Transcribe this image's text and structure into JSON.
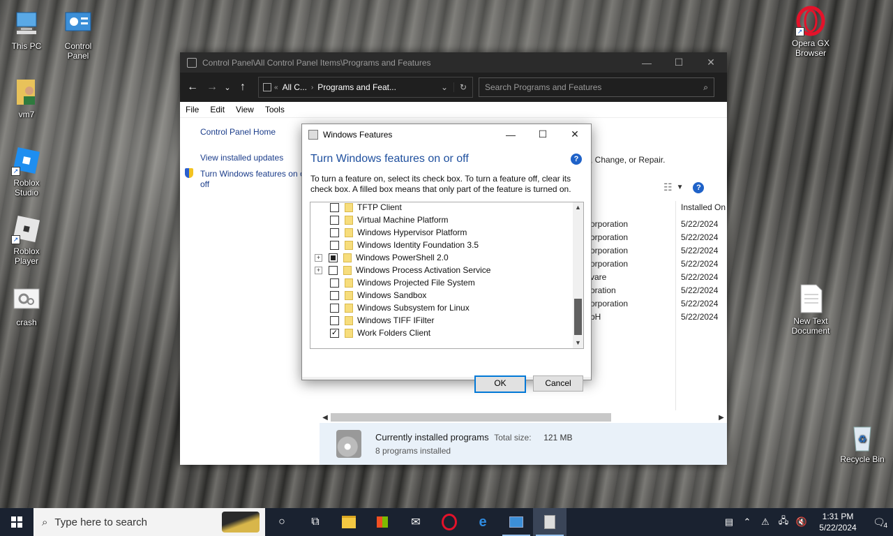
{
  "desktop": {
    "icons": [
      {
        "label": "This PC",
        "icon": "computer-icon"
      },
      {
        "label": "Control\nPanel",
        "icon": "control-panel-icon"
      },
      {
        "label": "vm7",
        "icon": "user-folder-icon"
      },
      {
        "label": "Roblox\nStudio",
        "icon": "roblox-studio-icon"
      },
      {
        "label": "Roblox\nPlayer",
        "icon": "roblox-player-icon"
      },
      {
        "label": "crash",
        "icon": "settings-file-icon"
      },
      {
        "label": "Opera GX\nBrowser",
        "icon": "opera-gx-icon"
      },
      {
        "label": "New Text\nDocument",
        "icon": "text-document-icon"
      },
      {
        "label": "Recycle Bin",
        "icon": "recycle-bin-icon"
      }
    ]
  },
  "cp_window": {
    "title": "Control Panel\\All Control Panel Items\\Programs and Features",
    "address": {
      "crumb1": "All C...",
      "crumb2": "Programs and Feat..."
    },
    "search_placeholder": "Search Programs and Features",
    "menu": [
      "File",
      "Edit",
      "View",
      "Tools"
    ],
    "left_links": {
      "home": "Control Panel Home",
      "updates": "View installed updates",
      "features_line1": "Turn Windows features on or",
      "features_line2": "off"
    },
    "right_text": ", Change, or Repair.",
    "column_installed_on": "Installed On",
    "rows": [
      {
        "publisher": "orporation",
        "date": "5/22/2024"
      },
      {
        "publisher": "orporation",
        "date": "5/22/2024"
      },
      {
        "publisher": "orporation",
        "date": "5/22/2024"
      },
      {
        "publisher": "orporation",
        "date": "5/22/2024"
      },
      {
        "publisher": "vare",
        "date": "5/22/2024"
      },
      {
        "publisher": "oration",
        "date": "5/22/2024"
      },
      {
        "publisher": "orporation",
        "date": "5/22/2024"
      },
      {
        "publisher": "bH",
        "date": "5/22/2024"
      }
    ],
    "status": {
      "title": "Currently installed programs",
      "total_label": "Total size:",
      "total_value": "121 MB",
      "count": "8 programs installed"
    }
  },
  "dialog": {
    "title": "Windows Features",
    "heading": "Turn Windows features on or off",
    "description": "To turn a feature on, select its check box. To turn a feature off, clear its check box. A filled box means that only part of the feature is turned on.",
    "features": [
      {
        "label": "TFTP Client",
        "state": "unchecked",
        "expandable": false
      },
      {
        "label": "Virtual Machine Platform",
        "state": "unchecked",
        "expandable": false
      },
      {
        "label": "Windows Hypervisor Platform",
        "state": "unchecked",
        "expandable": false
      },
      {
        "label": "Windows Identity Foundation 3.5",
        "state": "unchecked",
        "expandable": false
      },
      {
        "label": "Windows PowerShell 2.0",
        "state": "partial",
        "expandable": true
      },
      {
        "label": "Windows Process Activation Service",
        "state": "unchecked",
        "expandable": true
      },
      {
        "label": "Windows Projected File System",
        "state": "unchecked",
        "expandable": false
      },
      {
        "label": "Windows Sandbox",
        "state": "unchecked",
        "expandable": false
      },
      {
        "label": "Windows Subsystem for Linux",
        "state": "unchecked",
        "expandable": false
      },
      {
        "label": "Windows TIFF IFilter",
        "state": "unchecked",
        "expandable": false
      },
      {
        "label": "Work Folders Client",
        "state": "checked",
        "expandable": false
      }
    ],
    "ok_label": "OK",
    "cancel_label": "Cancel"
  },
  "taskbar": {
    "search_placeholder": "Type here to search",
    "apps": [
      "task-view-icon",
      "file-explorer-icon",
      "store-icon",
      "mail-icon",
      "opera-icon",
      "edge-icon",
      "control-panel-icon",
      "programs-features-icon"
    ],
    "time": "1:31 PM",
    "date": "5/22/2024",
    "notification_count": "4"
  }
}
